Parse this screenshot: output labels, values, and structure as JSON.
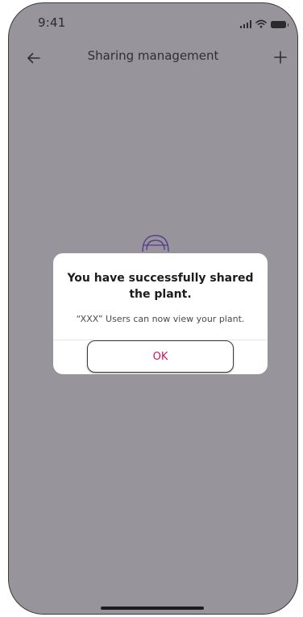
{
  "status_bar": {
    "time": "9:41"
  },
  "header": {
    "title": "Sharing management",
    "back_icon": "arrow-left-icon",
    "add_icon": "plus-icon"
  },
  "dialog": {
    "title": "You have successfully shared the plant.",
    "message": "“XXX” Users can now view your plant.",
    "ok_label": "OK"
  },
  "colors": {
    "overlay_background": "#97949c",
    "dialog_background": "#ffffff",
    "ok_text": "#c2185b",
    "illustration_stroke": "#5a3d8c"
  }
}
